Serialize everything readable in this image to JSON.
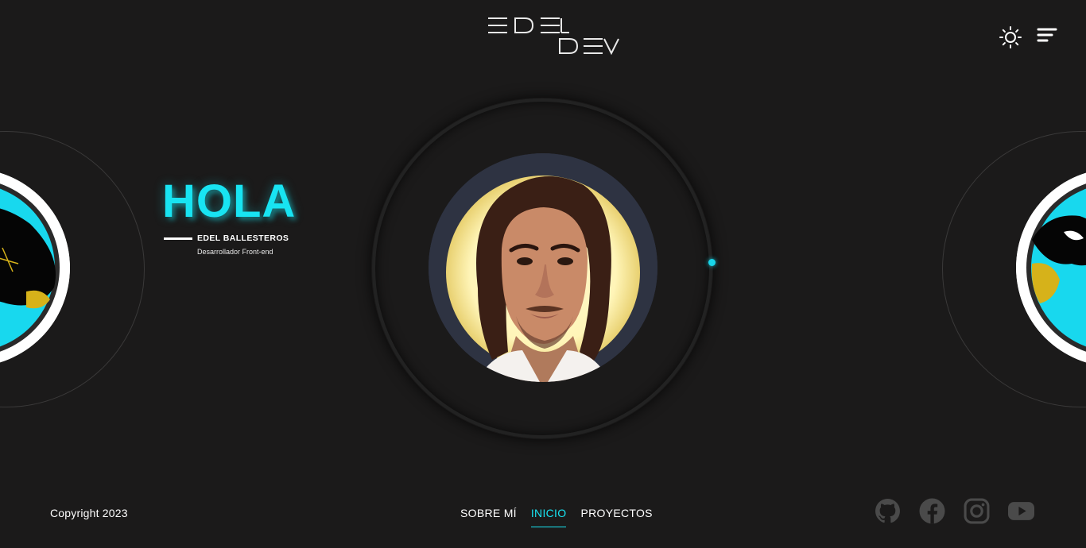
{
  "brand": {
    "logo_text": "EDEL DEV"
  },
  "header": {
    "theme_icon": "sun-icon",
    "menu_icon": "menu-icon"
  },
  "hero": {
    "greeting": "HOLA",
    "name": "EDEL BALLESTEROS",
    "role": "Desarrollador Front-end"
  },
  "footer": {
    "copyright": "Copyright 2023",
    "nav": [
      {
        "label": "SOBRE MÍ",
        "active": false
      },
      {
        "label": "INICIO",
        "active": true
      },
      {
        "label": "PROYECTOS",
        "active": false
      }
    ],
    "socials": [
      "github-icon",
      "facebook-icon",
      "instagram-icon",
      "youtube-icon"
    ]
  },
  "colors": {
    "background": "#1b1a1a",
    "accent": "#18e4f2",
    "text": "#ffffff",
    "social_icon": "#4a4a4a"
  }
}
